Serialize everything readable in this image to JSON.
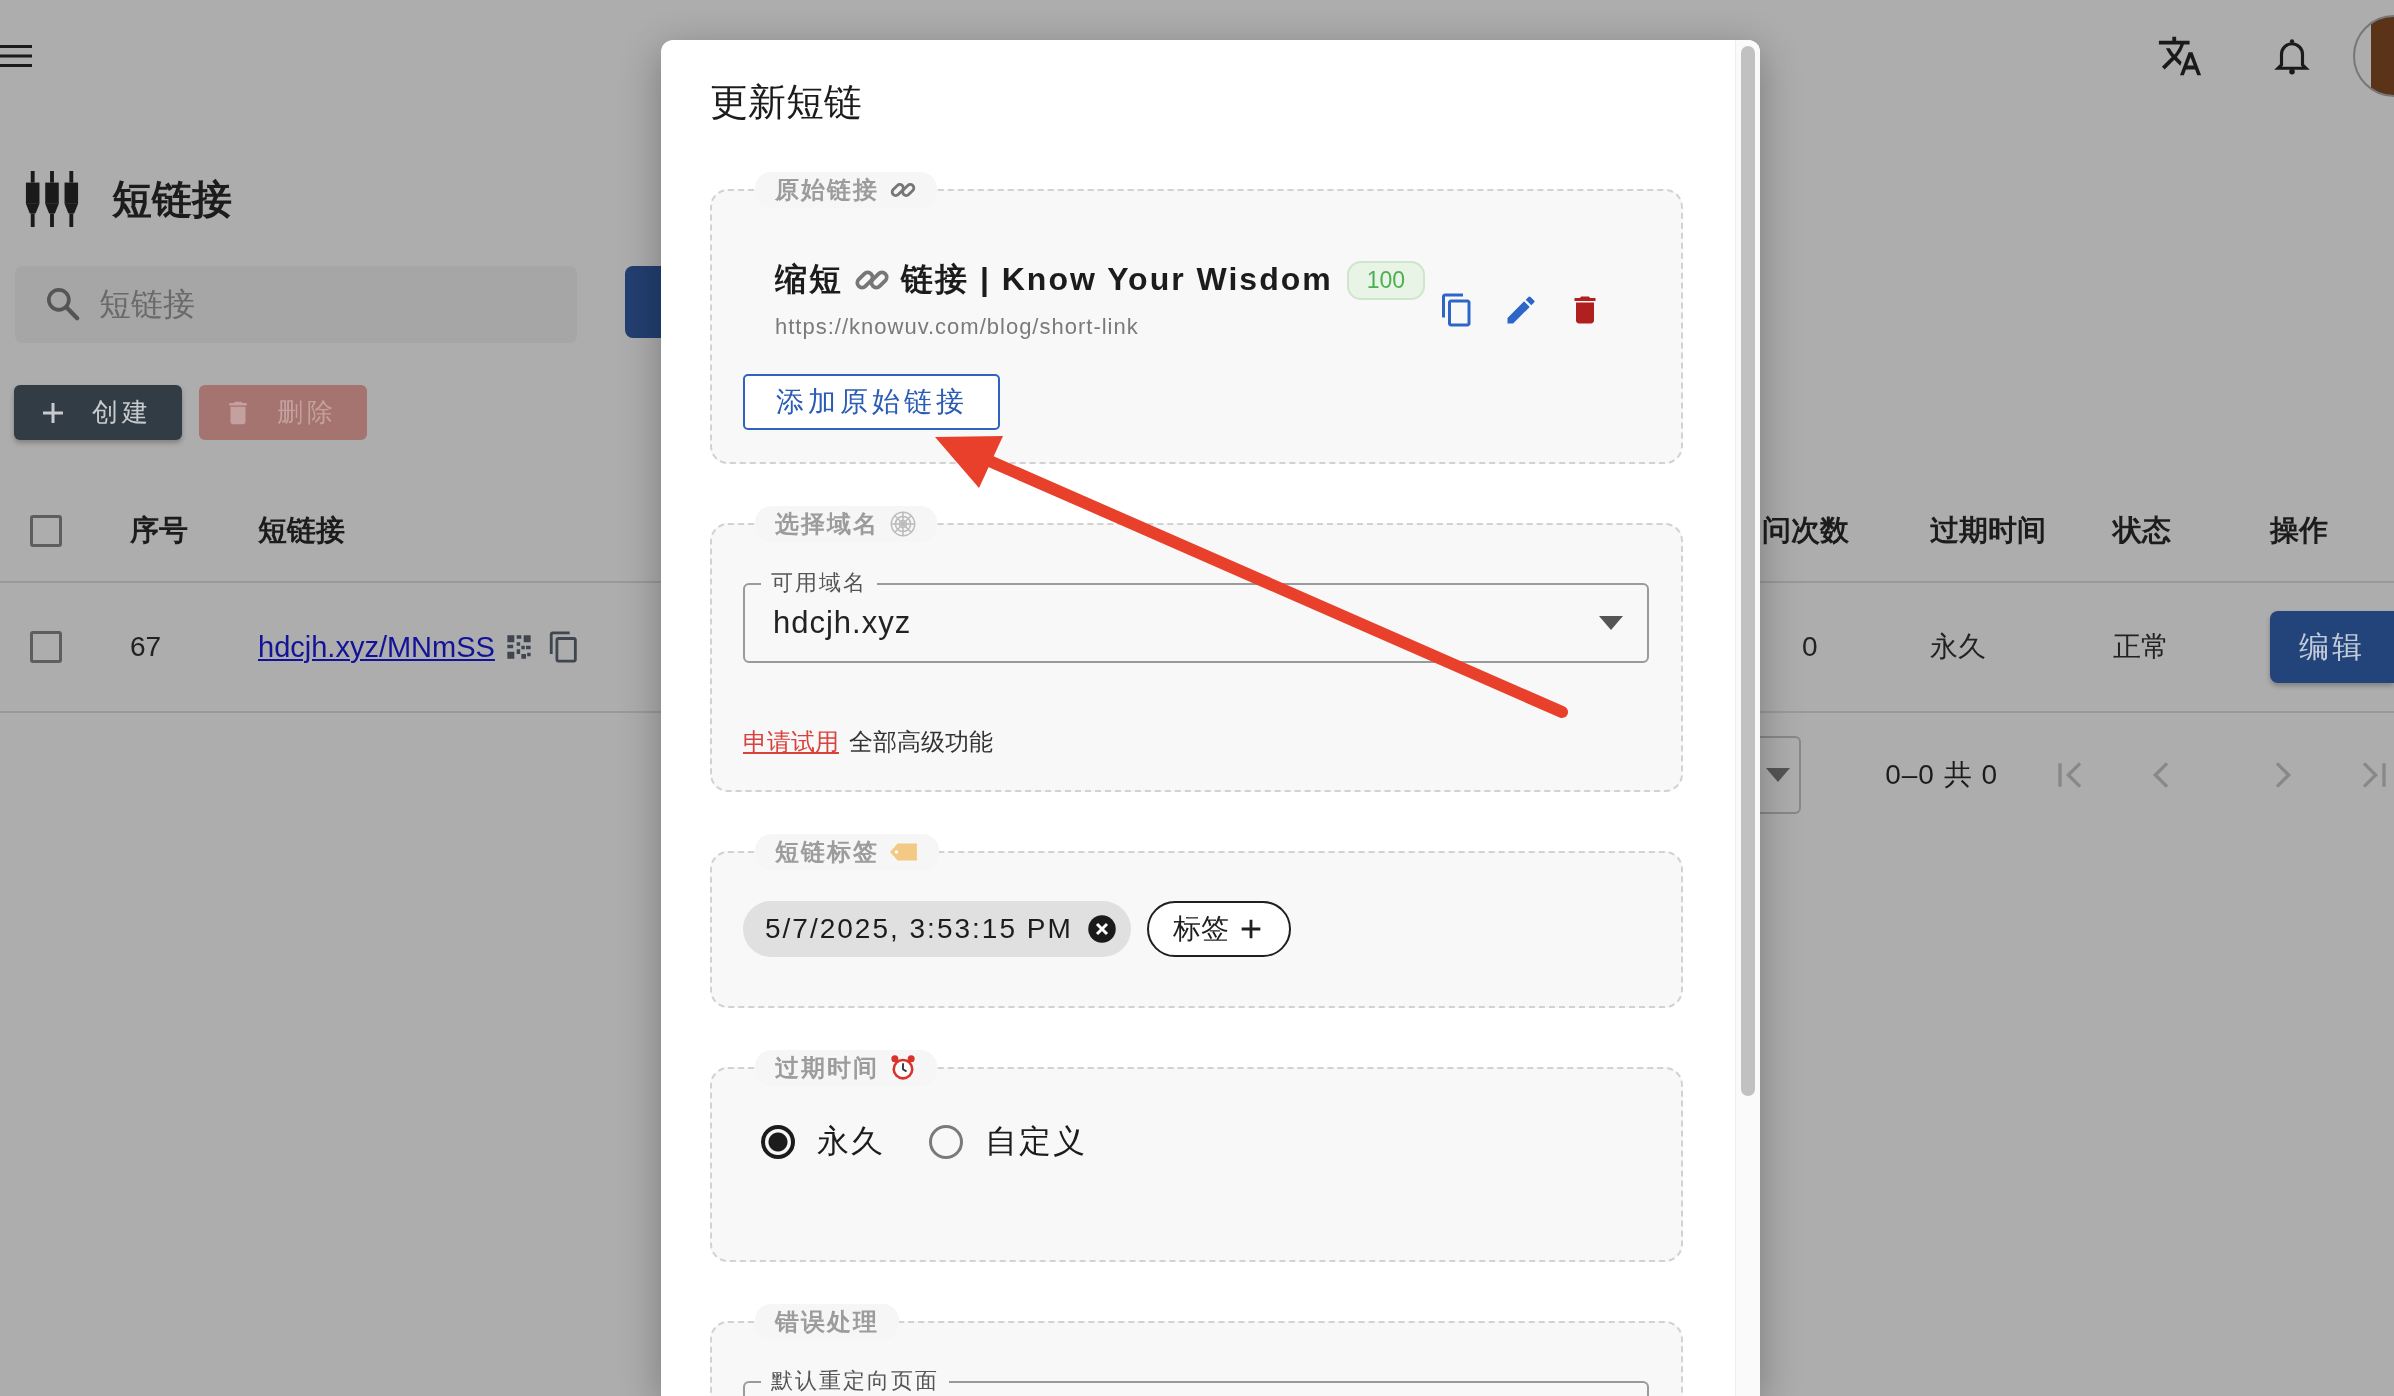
{
  "page": {
    "title": "短链接",
    "search": {
      "placeholder": "短链接"
    },
    "actions": [
      {
        "label": "创建",
        "kind": "create",
        "disabled": false
      },
      {
        "label": "删除",
        "kind": "delete",
        "disabled": true
      }
    ],
    "table": {
      "select_all_checked": false,
      "columns": [
        "序号",
        "短链接",
        "问次数",
        "过期时间",
        "状态",
        "操作"
      ],
      "rows": [
        {
          "checked": false,
          "cells": [
            "67",
            "hdcjh.xyz/MNmSS",
            "0",
            "永久",
            "正常"
          ],
          "action": "编辑"
        }
      ]
    },
    "pagination": {
      "range": "0–0 共 0"
    }
  },
  "dialog": {
    "title": "更新短链",
    "sections": [
      {
        "kind": "links",
        "legend": "原始链接",
        "links": [
          {
            "title_parts": [
              "缩短",
              "链接 | Know Your Wisdom"
            ],
            "badge": "100",
            "url": "https://knowuv.com/blog/short-link"
          }
        ],
        "add_button": "添加原始链接"
      },
      {
        "kind": "domain",
        "legend": "选择域名",
        "select": {
          "label": "可用域名",
          "value": "hdcjh.xyz"
        },
        "trial_link": "申请试用",
        "trial_text": "全部高级功能"
      },
      {
        "kind": "tags",
        "legend": "短链标签",
        "tags": [
          "5/7/2025, 3:53:15 PM"
        ],
        "add_button": "标签"
      },
      {
        "kind": "expiry",
        "legend": "过期时间",
        "options": [
          {
            "label": "永久",
            "selected": true
          },
          {
            "label": "自定义",
            "selected": false
          }
        ]
      },
      {
        "kind": "error",
        "legend": "错误处理",
        "select": {
          "label": "默认重定向页面"
        }
      }
    ]
  }
}
